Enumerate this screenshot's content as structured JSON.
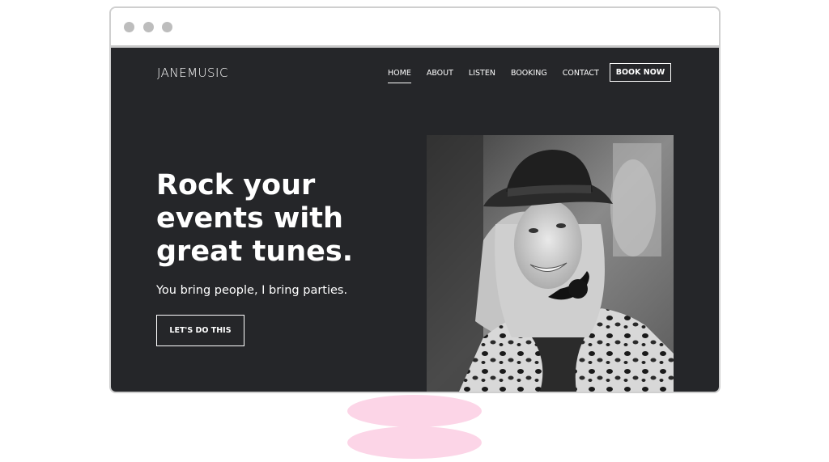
{
  "brand": {
    "logo": "JANEMUSIC"
  },
  "nav": {
    "items": [
      {
        "label": "HOME",
        "active": true
      },
      {
        "label": "ABOUT",
        "active": false
      },
      {
        "label": "LISTEN",
        "active": false
      },
      {
        "label": "BOOKING",
        "active": false
      },
      {
        "label": "CONTACT",
        "active": false
      }
    ],
    "cta_label": "BOOK NOW"
  },
  "hero": {
    "title": "Rock your events with great tunes.",
    "subtitle": "You bring people, I bring parties.",
    "cta_label": "LET'S DO THIS",
    "photo_icon": "woman-in-hat-portrait-image"
  },
  "colors": {
    "site_background": "#252629",
    "text": "#ffffff",
    "window_dots": "#bdbdbd",
    "accent_blob": "#fcd5e7"
  }
}
